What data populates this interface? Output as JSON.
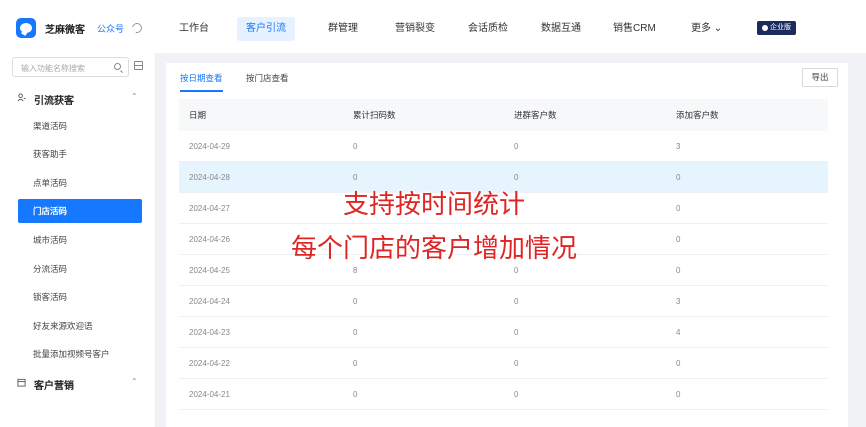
{
  "brand": {
    "name": "芝麻微客",
    "account": "公众号"
  },
  "nav": [
    {
      "label": "工作台",
      "active": false
    },
    {
      "label": "客户引流",
      "active": true
    },
    {
      "label": "群管理",
      "active": false
    },
    {
      "label": "营销裂变",
      "active": false
    },
    {
      "label": "会话质检",
      "active": false
    },
    {
      "label": "数据互通",
      "active": false
    },
    {
      "label": "销售CRM",
      "active": false
    },
    {
      "label": "更多 ⌄",
      "active": false
    }
  ],
  "edition_badge": "企业版",
  "search": {
    "placeholder": "输入功能名称搜索"
  },
  "sidebar": {
    "group1": {
      "label": "引流获客",
      "caret": "⌃"
    },
    "items": [
      {
        "label": "渠道活码",
        "active": false
      },
      {
        "label": "获客助手",
        "active": false
      },
      {
        "label": "点单活码",
        "active": false
      },
      {
        "label": "门店活码",
        "active": true
      },
      {
        "label": "城市活码",
        "active": false
      },
      {
        "label": "分流活码",
        "active": false
      },
      {
        "label": "锁客活码",
        "active": false
      },
      {
        "label": "好友来源欢迎语",
        "active": false
      },
      {
        "label": "批量添加视频号客户",
        "active": false
      }
    ],
    "group2": {
      "label": "客户营销",
      "caret": "⌃"
    }
  },
  "tabs": [
    {
      "label": "按日期查看",
      "active": true
    },
    {
      "label": "按门店查看",
      "active": false
    }
  ],
  "export_label": "导出",
  "table": {
    "headers": [
      "日期",
      "累计扫码数",
      "进群客户数",
      "添加客户数"
    ],
    "rows": [
      [
        "2024-04-29",
        "0",
        "0",
        "3"
      ],
      [
        "2024-04-28",
        "0",
        "0",
        "0"
      ],
      [
        "2024-04-27",
        "",
        "",
        "0"
      ],
      [
        "2024-04-26",
        "",
        "",
        "0"
      ],
      [
        "2024-04-25",
        "8",
        "0",
        "0"
      ],
      [
        "2024-04-24",
        "0",
        "0",
        "3"
      ],
      [
        "2024-04-23",
        "0",
        "0",
        "4"
      ],
      [
        "2024-04-22",
        "0",
        "0",
        "0"
      ],
      [
        "2024-04-21",
        "0",
        "0",
        "0"
      ]
    ],
    "highlighted_row": 1
  },
  "overlay": {
    "line1": "支持按时间统计",
    "line2": "每个门店的客户增加情况",
    "color": "#e02424"
  },
  "colors": {
    "accent": "#1677ff",
    "badge": "#1c2b5e"
  }
}
